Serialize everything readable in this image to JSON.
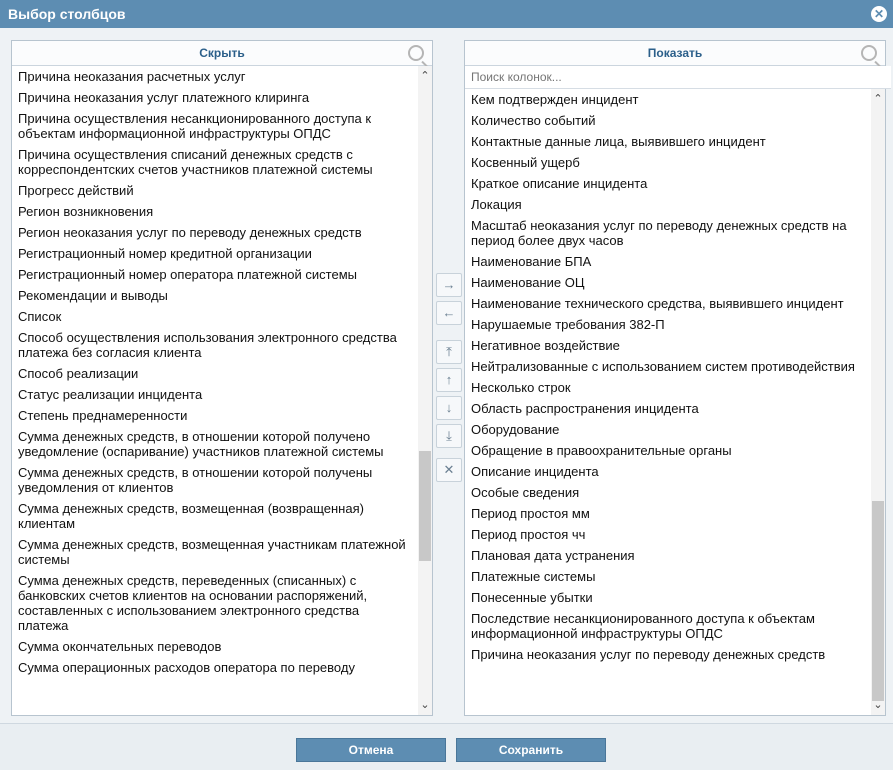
{
  "dialog": {
    "title": "Выбор столбцов",
    "close_icon": "close-icon"
  },
  "left_panel": {
    "title": "Скрыть",
    "items": [
      "Причина неоказания расчетных услуг",
      "Причина неоказания услуг платежного клиринга",
      "Причина осуществления несанкционированного доступа к объектам информационной инфраструктуры ОПДС",
      "Причина осуществления списаний денежных средств с корреспондентских счетов участников платежной системы",
      "Прогресс действий",
      "Регион возникновения",
      "Регион неоказания услуг по переводу денежных средств",
      "Регистрационный номер кредитной организации",
      "Регистрационный номер оператора платежной системы",
      "Рекомендации и выводы",
      "Список",
      "Способ осуществления использования электронного средства платежа без согласия клиента",
      "Способ реализации",
      "Статус реализации инцидента",
      "Степень преднамеренности",
      "Сумма денежных средств, в отношении которой получено уведомление (оспаривание) участников платежной системы",
      "Сумма денежных средств, в отношении которой получены уведомления от клиентов",
      "Сумма денежных средств, возмещенная (возвращенная) клиентам",
      "Сумма денежных средств, возмещенная участникам платежной системы",
      "Сумма денежных средств, переведенных (списанных) с банковских счетов клиентов на основании распоряжений, составленных с использованием электронного средства платежа",
      "Сумма окончательных переводов",
      "Сумма операционных расходов оператора по переводу"
    ]
  },
  "right_panel": {
    "title": "Показать",
    "search_placeholder": "Поиск колонок...",
    "items": [
      "Кем подтвержден инцидент",
      "Количество событий",
      "Контактные данные лица, выявившего инцидент",
      "Косвенный ущерб",
      "Краткое описание инцидента",
      "Локация",
      "Масштаб неоказания услуг по переводу денежных средств на период более двух часов",
      "Наименование БПА",
      "Наименование ОЦ",
      "Наименование технического средства, выявившего инцидент",
      "Нарушаемые требования 382-П",
      "Негативное воздействие",
      "Нейтрализованные с использованием систем противодействия",
      "Несколько строк",
      "Область распространения инцидента",
      "Оборудование",
      "Обращение в правоохранительные органы",
      "Описание инцидента",
      "Особые сведения",
      "Период простоя мм",
      "Период простоя чч",
      "Плановая дата устранения",
      "Платежные системы",
      "Понесенные убытки",
      "Последствие несанкционированного доступа к объектам информационной инфраструктуры ОПДС",
      "Причина неоказания услуг по переводу денежных средств"
    ]
  },
  "middle_buttons": [
    {
      "name": "move-right-button",
      "glyph": "→"
    },
    {
      "name": "move-left-button",
      "glyph": "←"
    },
    {
      "name": "move-top-button",
      "glyph": "⤒"
    },
    {
      "name": "move-up-button",
      "glyph": "↑"
    },
    {
      "name": "move-down-button",
      "glyph": "↓"
    },
    {
      "name": "move-bottom-button",
      "glyph": "⤓"
    },
    {
      "name": "remove-button",
      "glyph": "✕"
    }
  ],
  "footer": {
    "cancel_label": "Отмена",
    "save_label": "Сохранить"
  }
}
